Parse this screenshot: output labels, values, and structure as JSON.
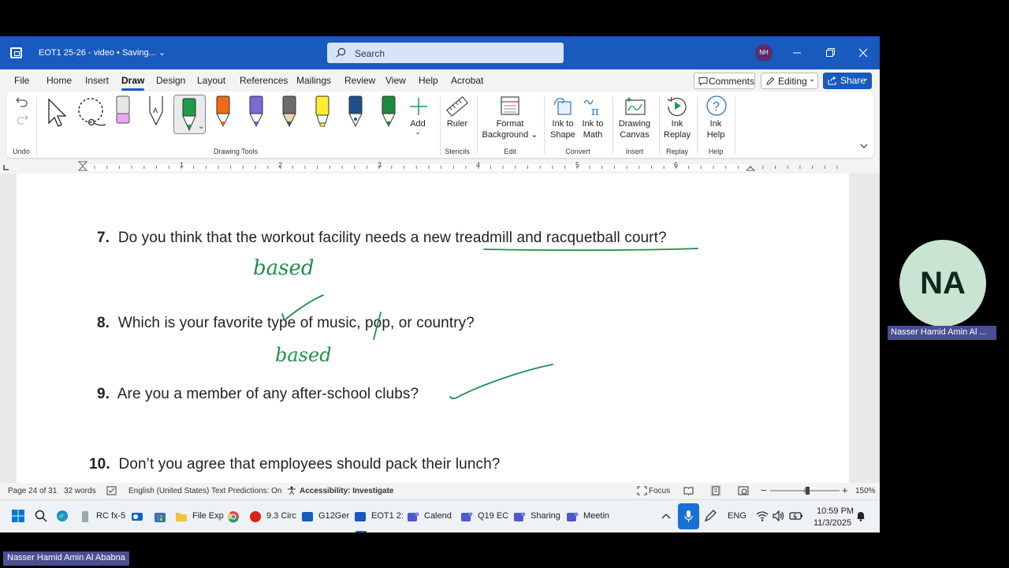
{
  "titlebar": {
    "doc_title": "EOT1 25-26 - video • Saving... ⌄",
    "search_placeholder": "Search",
    "avatar_initials": "NH"
  },
  "menu": {
    "items": [
      "File",
      "Home",
      "Insert",
      "Draw",
      "Design",
      "Layout",
      "References",
      "Mailings",
      "Review",
      "View",
      "Help",
      "Acrobat"
    ],
    "active": "Draw",
    "comments": "Comments",
    "editing": "Editing",
    "share": "Share"
  },
  "ribbon": {
    "groups": {
      "undo": "Undo",
      "drawing_tools": "Drawing Tools",
      "stencils": "Stencils",
      "edit": "Edit",
      "convert": "Convert",
      "insert": "Insert",
      "replay": "Replay",
      "help": "Help"
    },
    "add": "Add",
    "ruler": "Ruler",
    "format_background_1": "Format",
    "format_background_2": "Background ⌄",
    "ink_to_shape_1": "Ink to",
    "ink_to_shape_2": "Shape",
    "ink_to_math_1": "Ink to",
    "ink_to_math_2": "Math",
    "drawing_canvas_1": "Drawing",
    "drawing_canvas_2": "Canvas",
    "ink_replay_1": "Ink",
    "ink_replay_2": "Replay",
    "ink_help_1": "Ink",
    "ink_help_2": "Help",
    "pen_colors": [
      "#e7a7ee",
      "#ffffff",
      "#1f9a4a",
      "#f06a16",
      "#7a6ad8",
      "#6b6b6b",
      "#ffee2e",
      "#1f4f8f",
      "#1d8a3e"
    ]
  },
  "ruler": {
    "numbers": [
      "1",
      "2",
      "3",
      "4",
      "5",
      "6"
    ]
  },
  "document": {
    "questions": [
      {
        "num": "7.",
        "text": "Do you think that the workout facility needs a new treadmill and racquetball court?"
      },
      {
        "num": "8.",
        "text": "Which is your favorite type of music, pop, or country?"
      },
      {
        "num": "9.",
        "text": "Are you a member of any after-school clubs?"
      },
      {
        "num": "10.",
        "text": "Don’t you agree that employees should pack their lunch?"
      }
    ],
    "ink_annotations": [
      "based",
      "based"
    ],
    "ink_color": "#1f8f4a"
  },
  "statusbar": {
    "page": "Page 24 of 31",
    "words": "32 words",
    "language": "English (United States)",
    "predictions": "Text Predictions: On",
    "accessibility": "Accessibility: Investigate",
    "focus": "Focus",
    "zoom": "150%"
  },
  "taskbar": {
    "apps": [
      "RC fx-5",
      "",
      "",
      "File Exp",
      "",
      "9.3 Circ",
      "G12Ger",
      "EOT1 2:",
      "Calend",
      "Q19 EC",
      "Sharing",
      "Meetin"
    ],
    "language": "ENG",
    "time": "10:59 PM",
    "date": "11/3/2025"
  },
  "participant": {
    "initials": "NA",
    "name": "Nasser Hamid Amin Al  ...",
    "color": "#c9e4d2"
  },
  "presenter_label": "Nasser Hamid Amin Al  Ababna"
}
